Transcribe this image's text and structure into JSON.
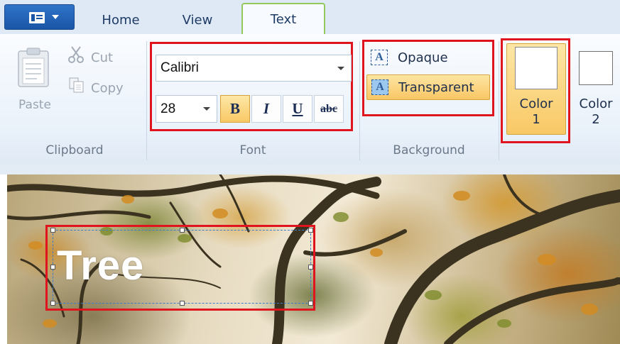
{
  "tabs": {
    "home": "Home",
    "view": "View",
    "text": "Text",
    "active": "Text"
  },
  "clipboard": {
    "paste_label": "Paste",
    "cut_label": "Cut",
    "copy_label": "Copy",
    "group_label": "Clipboard"
  },
  "font": {
    "family_value": "Calibri",
    "size_value": "28",
    "bold_glyph": "B",
    "italic_glyph": "I",
    "underline_glyph": "U",
    "strike_glyph": "abc",
    "bold_active": true,
    "group_label": "Font"
  },
  "background": {
    "opaque_label": "Opaque",
    "transparent_label": "Transparent",
    "icon_glyph": "A",
    "selected": "Transparent",
    "group_label": "Background"
  },
  "colors": {
    "color1_line1": "Color",
    "color1_line2": "1",
    "color2_line1": "Color",
    "color2_line2": "2",
    "color1_value": "#ffffff",
    "color2_value": "#ffffff"
  },
  "canvas": {
    "text_value": "Tree",
    "text_color": "#ffffff"
  },
  "theme": {
    "highlight_outline": "#e0141e",
    "selected_fill": "#f9c865",
    "active_tab_border": "#92c95e"
  }
}
